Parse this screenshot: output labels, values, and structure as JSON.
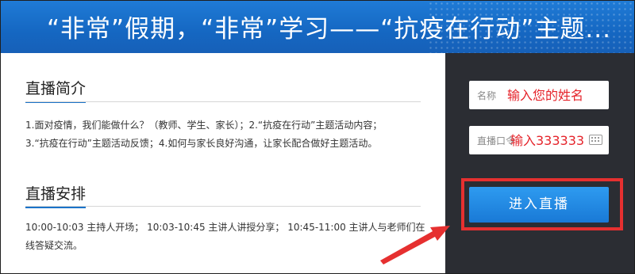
{
  "banner": {
    "title": "“非常”假期，“非常”学习——“抗疫在行动”主题..."
  },
  "intro": {
    "heading": "直播简介",
    "line1": "1.面对疫情，我们能做什么？（教师、学生、家长）；2.“抗疫在行动”主题活动内容；",
    "line2": "3.“抗疫在行动”主题活动反馈；4.如何与家长良好沟通，让家长配合做好主题活动。"
  },
  "schedule": {
    "heading": "直播安排",
    "line1": "10:00-10:03  主持人开场；  10:03-10:45  主讲人讲授分享；  10:45-11:00  主讲人与老师们在",
    "line2": "线答疑交流。"
  },
  "login": {
    "name_label": "名称",
    "name_value": "输入您的姓名",
    "password_label": "直播口令",
    "password_value": "输入333333",
    "enter_label": "进入直播"
  },
  "colors": {
    "banner": "#1567c2",
    "panel": "#2b2d33",
    "button": "#1979d6",
    "annotation": "#e63030"
  }
}
